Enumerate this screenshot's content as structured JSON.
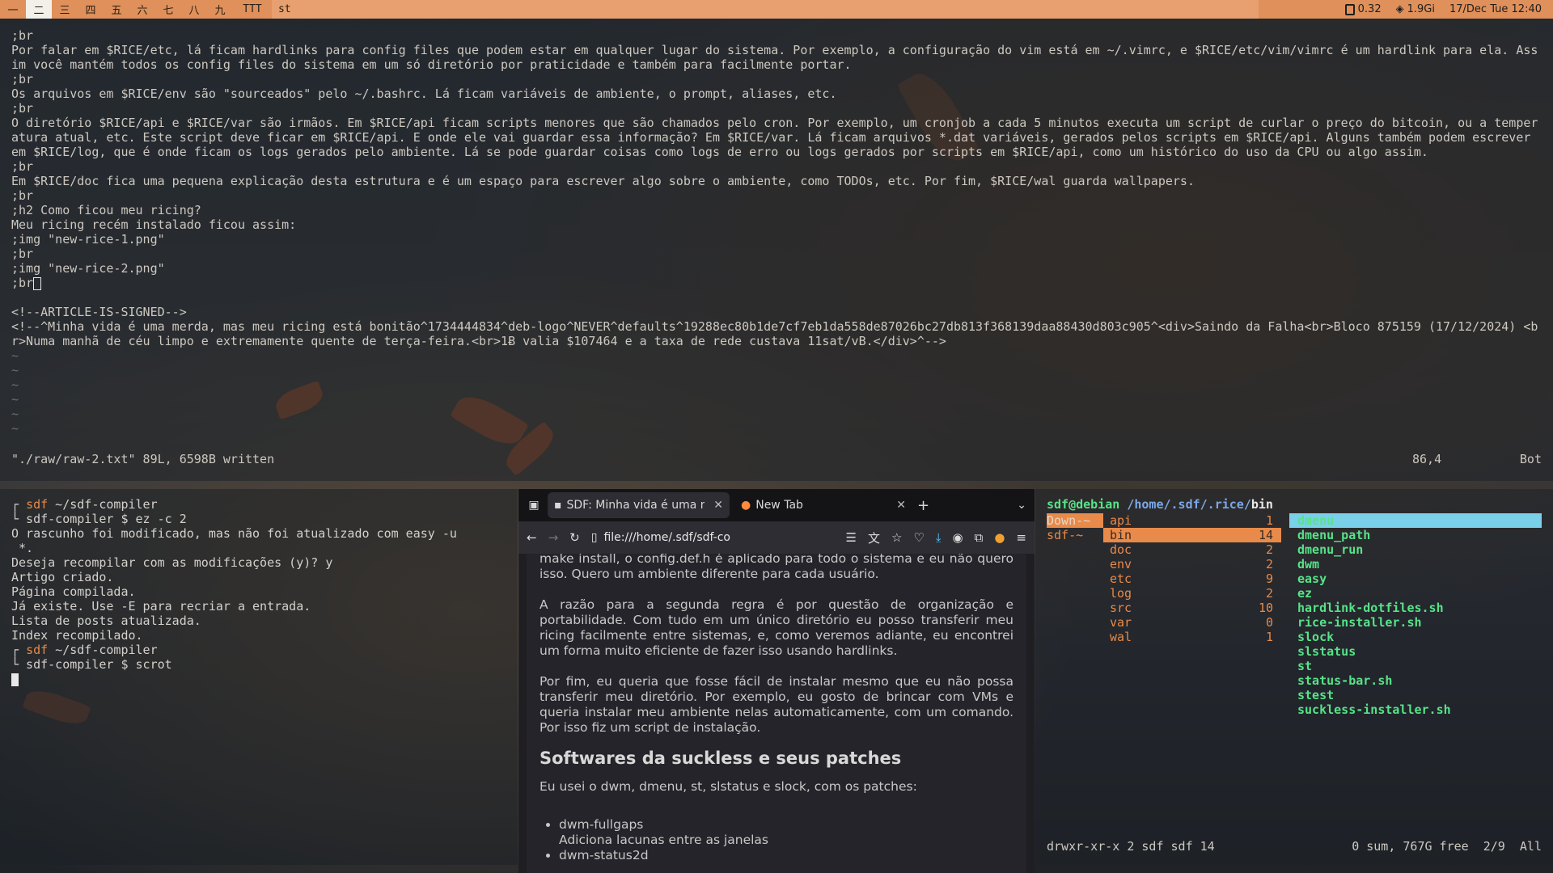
{
  "bar": {
    "tags": [
      "一",
      "二",
      "三",
      "四",
      "五",
      "六",
      "七",
      "八",
      "九"
    ],
    "layout": "TTT",
    "window_title": "st",
    "battery": "0.32",
    "memory": "1.9Gi",
    "datetime": "17/Dec Tue 12:40"
  },
  "vim": {
    "lines": [
      ";br",
      "Por falar em $RICE/etc, lá ficam hardlinks para config files que podem estar em qualquer lugar do sistema. Por exemplo, a configuração do vim está em ~/.vimrc, e $RICE/etc/vim/vimrc é um hardlink para ela. Assim você mantém todos os config files do sistema em um só diretório por praticidade e também para facilmente portar.",
      ";br",
      "Os arquivos em $RICE/env são \"sourceados\" pelo ~/.bashrc. Lá ficam variáveis de ambiente, o prompt, aliases, etc.",
      ";br",
      "O diretório $RICE/api e $RICE/var são irmãos. Em $RICE/api ficam scripts menores que são chamados pelo cron. Por exemplo, um cronjob a cada 5 minutos executa um script de curlar o preço do bitcoin, ou a temperatura atual, etc. Este script deve ficar em $RICE/api. E onde ele vai guardar essa informação? Em $RICE/var. Lá ficam arquivos *.dat variáveis, gerados pelos scripts em $RICE/api. Alguns também podem escrever em $RICE/log, que é onde ficam os logs gerados pelo ambiente. Lá se pode guardar coisas como logs de erro ou logs gerados por scripts em $RICE/api, como um histórico do uso da CPU ou algo assim.",
      ";br",
      "Em $RICE/doc fica uma pequena explicação desta estrutura e é um espaço para escrever algo sobre o ambiente, como TODOs, etc. Por fim, $RICE/wal guarda wallpapers.",
      ";br",
      ";h2 Como ficou meu ricing?",
      "Meu ricing recém instalado ficou assim:",
      ";img \"new-rice-1.png\"",
      ";br",
      ";img \"new-rice-2.png\"",
      ";br"
    ],
    "signed_line": "<!--ARTICLE-IS-SIGNED-->",
    "sig_line": "<!--^Minha vida é uma merda, mas meu ricing está bonitão^1734444834^deb-logo^NEVER^defaults^19288ec80b1de7cf7eb1da558de87026bc27db813f368139daa88430d803c905^<div>Saindo da Falha<br>Bloco 875159 (17/12/2024) <br>Numa manhã de céu limpo e extremamente quente de terça-feira.<br>1Ƀ valia $107464 e a taxa de rede custava 11sat/vB.</div>^-->",
    "tildes": [
      "~",
      "~",
      "~",
      "~",
      "~",
      "~"
    ],
    "status_msg": "\"./raw/raw-2.txt\" 89L, 6598B written",
    "cursor_pos": "86,4",
    "scroll": "Bot"
  },
  "term": {
    "prompt1_user": "sdf",
    "prompt1_path": " ~/sdf-compiler",
    "cmd1": "└ sdf-compiler $ ez -c 2",
    "output": [
      "O rascunho foi modificado, mas não foi atualizado com easy -u",
      " *.",
      "Deseja recompilar com as modificações (y)? y",
      "Artigo criado.",
      "Página compilada.",
      "Já existe. Use -E para recriar a entrada.",
      "Lista de posts atualizada.",
      "Index recompilado."
    ],
    "prompt2_user": "sdf",
    "prompt2_path": " ~/sdf-compiler",
    "cmd2": "└ sdf-compiler $ scrot"
  },
  "browser": {
    "tab1_title": "SDF: Minha vida é uma m",
    "tab2_title": "New Tab",
    "url": "file:///home/.sdf/sdf-co",
    "content": {
      "top_fragment": "make install, o config.def.h é aplicado para todo o sistema e eu não quero isso. Quero um ambiente diferente para cada usuário.",
      "p1": "A razão para a segunda regra é por questão de organização e portabilidade. Com tudo em um único diretório eu posso transferir meu ricing facilmente entre sistemas, e, como veremos adiante, eu encontrei um forma muito eficiente de fazer isso usando hardlinks.",
      "p2": "Por fim, eu queria que fosse fácil de instalar mesmo que eu não possa transferir meu diretório. Por exemplo, eu gosto de brincar com VMs e queria instalar meu ambiente nelas automaticamente, com um comando. Por isso fiz um script de instalação.",
      "h2": "Softwares da suckless e seus patches",
      "p3": "Eu usei o dwm, dmenu, st, slstatus e slock, com os patches:",
      "li1": "dwm-fullgaps",
      "li1_desc": "Adiciona lacunas entre as janelas",
      "li2": "dwm-status2d"
    }
  },
  "ranger": {
    "user": "sdf@debian",
    "path": " /home/.sdf/.rice/",
    "current": "bin",
    "col1": [
      "Down-~",
      "sdf-~"
    ],
    "col2": [
      {
        "name": "api",
        "count": "1"
      },
      {
        "name": "bin",
        "count": "14"
      },
      {
        "name": "doc",
        "count": "2"
      },
      {
        "name": "env",
        "count": "2"
      },
      {
        "name": "etc",
        "count": "9"
      },
      {
        "name": "log",
        "count": "2"
      },
      {
        "name": "src",
        "count": "10"
      },
      {
        "name": "var",
        "count": "0"
      },
      {
        "name": "wal",
        "count": "1"
      }
    ],
    "col3": [
      "dmenu",
      "dmenu_path",
      "dmenu_run",
      "dwm",
      "easy",
      "ez",
      "hardlink-dotfiles.sh",
      "rice-installer.sh",
      "slock",
      "slstatus",
      "st",
      "status-bar.sh",
      "stest",
      "suckless-installer.sh"
    ],
    "perms": "drwxr-xr-x 2 sdf sdf 14",
    "summary": "0 sum, 767G free  2/9  All"
  },
  "colors": {
    "bar": "#e0905a",
    "accent": "#e88a4a",
    "ranger_file": "#57e388",
    "highlight": "#7ad0e8"
  }
}
